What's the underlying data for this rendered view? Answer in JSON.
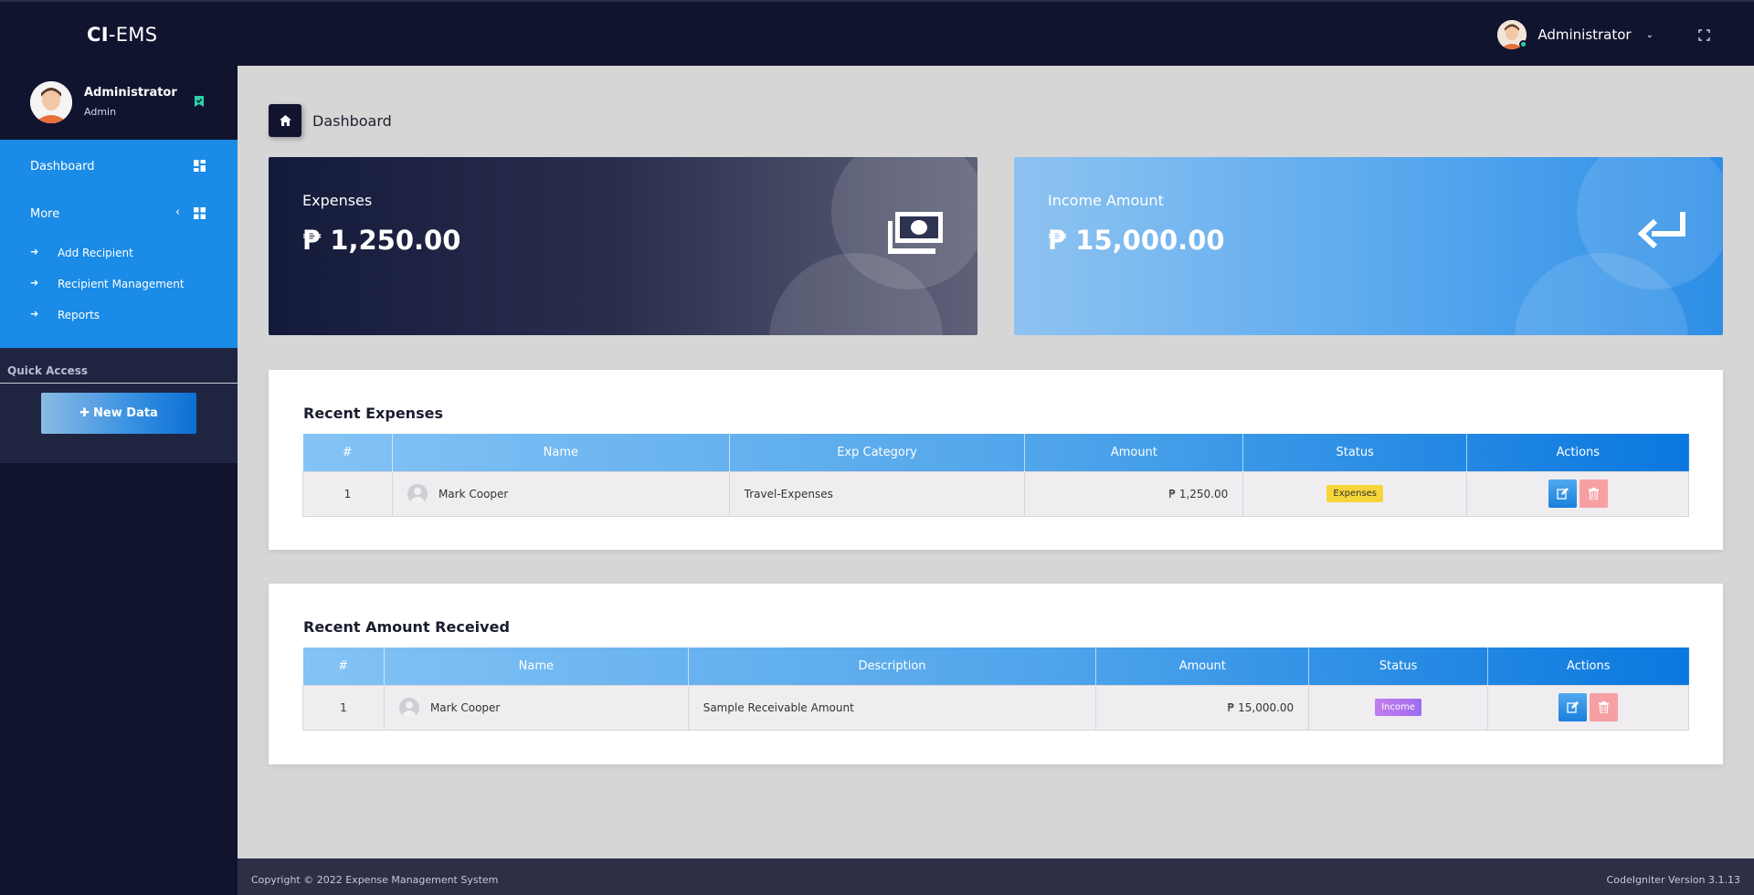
{
  "brand": {
    "prefix": "CI",
    "suffix": "-EMS"
  },
  "topbar": {
    "user_name": "Administrator"
  },
  "profile": {
    "name": "Administrator",
    "role": "Admin"
  },
  "nav": {
    "dashboard": "Dashboard",
    "more": "More",
    "sub_items": [
      {
        "label": "Add Recipient"
      },
      {
        "label": "Recipient Management"
      },
      {
        "label": "Reports"
      }
    ]
  },
  "quick_access": {
    "title": "Quick Access",
    "new_data_label": "New Data"
  },
  "breadcrumb": {
    "title": "Dashboard"
  },
  "cards": {
    "expenses": {
      "label": "Expenses",
      "value": "₱ 1,250.00"
    },
    "income": {
      "label": "Income Amount",
      "value": "₱ 15,000.00"
    }
  },
  "recent_expenses": {
    "title": "Recent Expenses",
    "columns": [
      "#",
      "Name",
      "Exp Category",
      "Amount",
      "Status",
      "Actions"
    ],
    "rows": [
      {
        "num": "1",
        "name": "Mark Cooper",
        "category": "Travel-Expenses",
        "amount": "₱ 1,250.00",
        "status": "Expenses"
      }
    ]
  },
  "recent_received": {
    "title": "Recent Amount Received",
    "columns": [
      "#",
      "Name",
      "Description",
      "Amount",
      "Status",
      "Actions"
    ],
    "rows": [
      {
        "num": "1",
        "name": "Mark Cooper",
        "description": "Sample Receivable Amount",
        "amount": "₱ 15,000.00",
        "status": "Income"
      }
    ]
  },
  "footer": {
    "copyright": "Copyright © 2022 Expense Management System",
    "version": "CodeIgniter Version 3.1.13"
  },
  "colors": {
    "sidebar_bg": "#10142f",
    "nav_accent": "#1a8be6",
    "expense_tag": "#f6d53a",
    "income_tag": "#b075ee"
  }
}
